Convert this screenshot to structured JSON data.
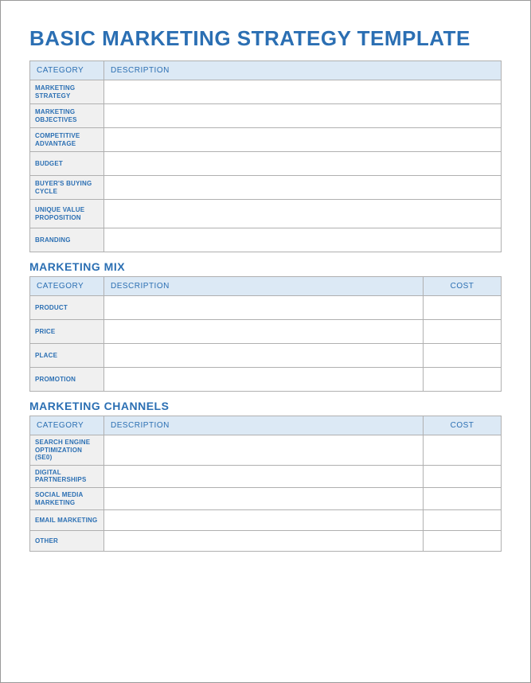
{
  "title": "BASIC MARKETING STRATEGY TEMPLATE",
  "table1": {
    "headers": {
      "category": "CATEGORY",
      "description": "DESCRIPTION"
    },
    "rows": [
      {
        "label": "MARKETING STRATEGY",
        "desc": ""
      },
      {
        "label": "MARKETING OBJECTIVES",
        "desc": ""
      },
      {
        "label": "COMPETITIVE ADVANTAGE",
        "desc": ""
      },
      {
        "label": "BUDGET",
        "desc": ""
      },
      {
        "label": "BUYER'S BUYING CYCLE",
        "desc": ""
      },
      {
        "label": "UNIQUE VALUE PROPOSITION",
        "desc": ""
      },
      {
        "label": "BRANDING",
        "desc": ""
      }
    ]
  },
  "section2": {
    "title": "MARKETING MIX",
    "headers": {
      "category": "CATEGORY",
      "description": "DESCRIPTION",
      "cost": "COST"
    },
    "rows": [
      {
        "label": "PRODUCT",
        "desc": "",
        "cost": ""
      },
      {
        "label": "PRICE",
        "desc": "",
        "cost": ""
      },
      {
        "label": "PLACE",
        "desc": "",
        "cost": ""
      },
      {
        "label": "PROMOTION",
        "desc": "",
        "cost": ""
      }
    ]
  },
  "section3": {
    "title": "MARKETING CHANNELS",
    "headers": {
      "category": "CATEGORY",
      "description": "DESCRIPTION",
      "cost": "COST"
    },
    "rows": [
      {
        "label": "SEARCH ENGINE OPTIMIZATION (SE0)",
        "desc": "",
        "cost": ""
      },
      {
        "label": "DIGITAL PARTNERSHIPS",
        "desc": "",
        "cost": ""
      },
      {
        "label": "SOCIAL MEDIA MARKETING",
        "desc": "",
        "cost": ""
      },
      {
        "label": "EMAIL MARKETING",
        "desc": "",
        "cost": ""
      },
      {
        "label": "OTHER",
        "desc": "",
        "cost": ""
      }
    ]
  }
}
